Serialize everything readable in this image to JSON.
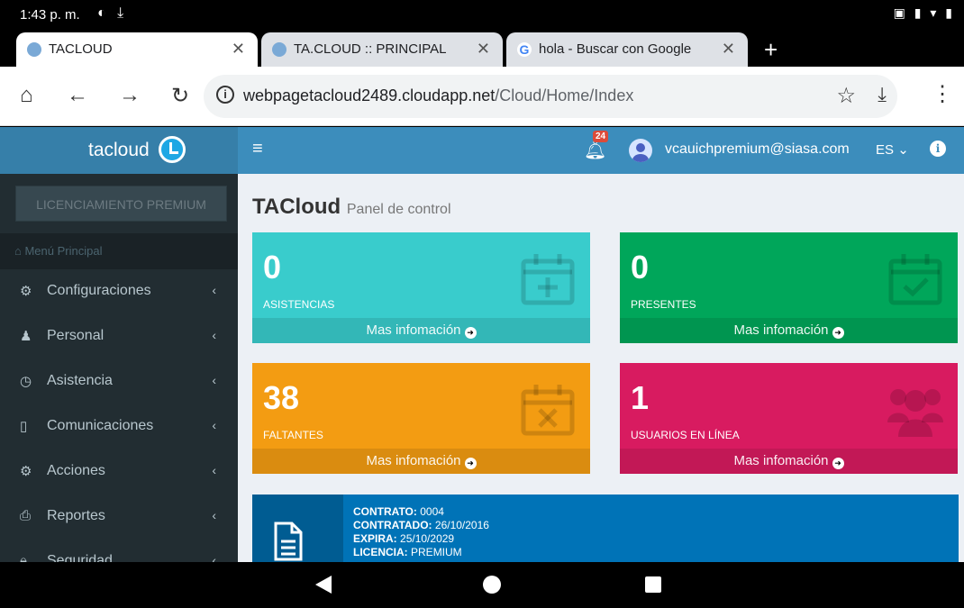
{
  "status": {
    "time": "1:43 p. m."
  },
  "tabs": [
    {
      "title": "TACLOUD",
      "active": true
    },
    {
      "title": "TA.CLOUD :: PRINCIPAL",
      "active": false
    },
    {
      "title": "hola - Buscar con Google",
      "active": false
    }
  ],
  "browser": {
    "url_host": "webpagetacloud2489.cloudapp.net",
    "url_path": "/Cloud/Home/Index"
  },
  "sidebar": {
    "logo": "tacloud",
    "license_button": "LICENCIAMIENTO PREMIUM",
    "menu_header": "Menú Principal",
    "items": [
      {
        "label": "Configuraciones",
        "icon": "cogs-icon"
      },
      {
        "label": "Personal",
        "icon": "user-icon"
      },
      {
        "label": "Asistencia",
        "icon": "clock-icon"
      },
      {
        "label": "Comunicaciones",
        "icon": "mobile-icon"
      },
      {
        "label": "Acciones",
        "icon": "cogs-icon"
      },
      {
        "label": "Reportes",
        "icon": "print-icon"
      },
      {
        "label": "Seguridad",
        "icon": "lock-icon"
      }
    ]
  },
  "topbar": {
    "notifications": "24",
    "user": "vcauichpremium@siasa.com",
    "language": "ES"
  },
  "content": {
    "title": "TACloud",
    "subtitle": "Panel de control"
  },
  "boxes": [
    {
      "value": "0",
      "label": "ASISTENCIAS",
      "footer": "Mas infomación",
      "color": "#39cccc"
    },
    {
      "value": "0",
      "label": "PRESENTES",
      "footer": "Mas infomación",
      "color": "#00a65a"
    },
    {
      "value": "38",
      "label": "FALTANTES",
      "footer": "Mas infomación",
      "color": "#f39c12"
    },
    {
      "value": "1",
      "label": "USUARIOS EN LÍNEA",
      "footer": "Mas infomación",
      "color": "#d81b60"
    }
  ],
  "contract": {
    "contrato_label": "CONTRATO:",
    "contrato": "0004",
    "contratado_label": "CONTRATADO:",
    "contratado": "26/10/2016",
    "expira_label": "EXPIRA:",
    "expira": "25/10/2029",
    "licencia_label": "LICENCIA:",
    "licencia": "PREMIUM"
  }
}
